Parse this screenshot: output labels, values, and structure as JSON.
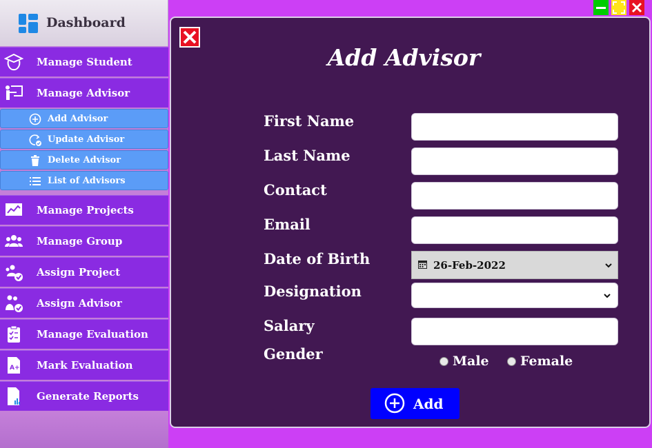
{
  "window": {
    "minimize_color": "#00cc00",
    "maximize_color": "#ffe51a",
    "close_color": "#e81123"
  },
  "sidebar": {
    "dashboard_label": "Dashboard",
    "items": [
      {
        "label": "Manage Student",
        "icon": "graduation-cap-icon"
      },
      {
        "label": "Manage Advisor",
        "icon": "teacher-board-icon"
      },
      {
        "label": "Manage Projects",
        "icon": "chart-board-icon"
      },
      {
        "label": "Manage Group",
        "icon": "group-icon"
      },
      {
        "label": "Assign Project",
        "icon": "group-check-icon"
      },
      {
        "label": "Assign Advisor",
        "icon": "users-check-icon"
      },
      {
        "label": "Manage Evaluation",
        "icon": "clipboard-check-icon"
      },
      {
        "label": "Mark Evaluation",
        "icon": "grade-paper-icon"
      },
      {
        "label": "Generate Reports",
        "icon": "report-icon"
      }
    ],
    "sub_items": [
      {
        "label": "Add Advisor",
        "icon": "plus-circle-icon"
      },
      {
        "label": "Update Advisor",
        "icon": "refresh-check-icon"
      },
      {
        "label": "Delete Advisor",
        "icon": "trash-icon"
      },
      {
        "label": "List of Advisors",
        "icon": "list-icon"
      }
    ]
  },
  "form": {
    "title": "Add Advisor",
    "labels": {
      "first_name": "First Name",
      "last_name": "Last Name",
      "contact": "Contact",
      "email": "Email",
      "dob": "Date of Birth",
      "designation": "Designation",
      "salary": "Salary",
      "gender": "Gender"
    },
    "values": {
      "first_name": "",
      "last_name": "",
      "contact": "",
      "email": "",
      "dob": "26-Feb-2022",
      "designation": "",
      "salary": ""
    },
    "gender_options": [
      "Male",
      "Female"
    ],
    "add_label": "Add"
  },
  "colors": {
    "sidebar_item": "#8a2be2",
    "sub_item": "#5b9cf7",
    "panel": "#421852",
    "add_button": "#0000ff"
  }
}
